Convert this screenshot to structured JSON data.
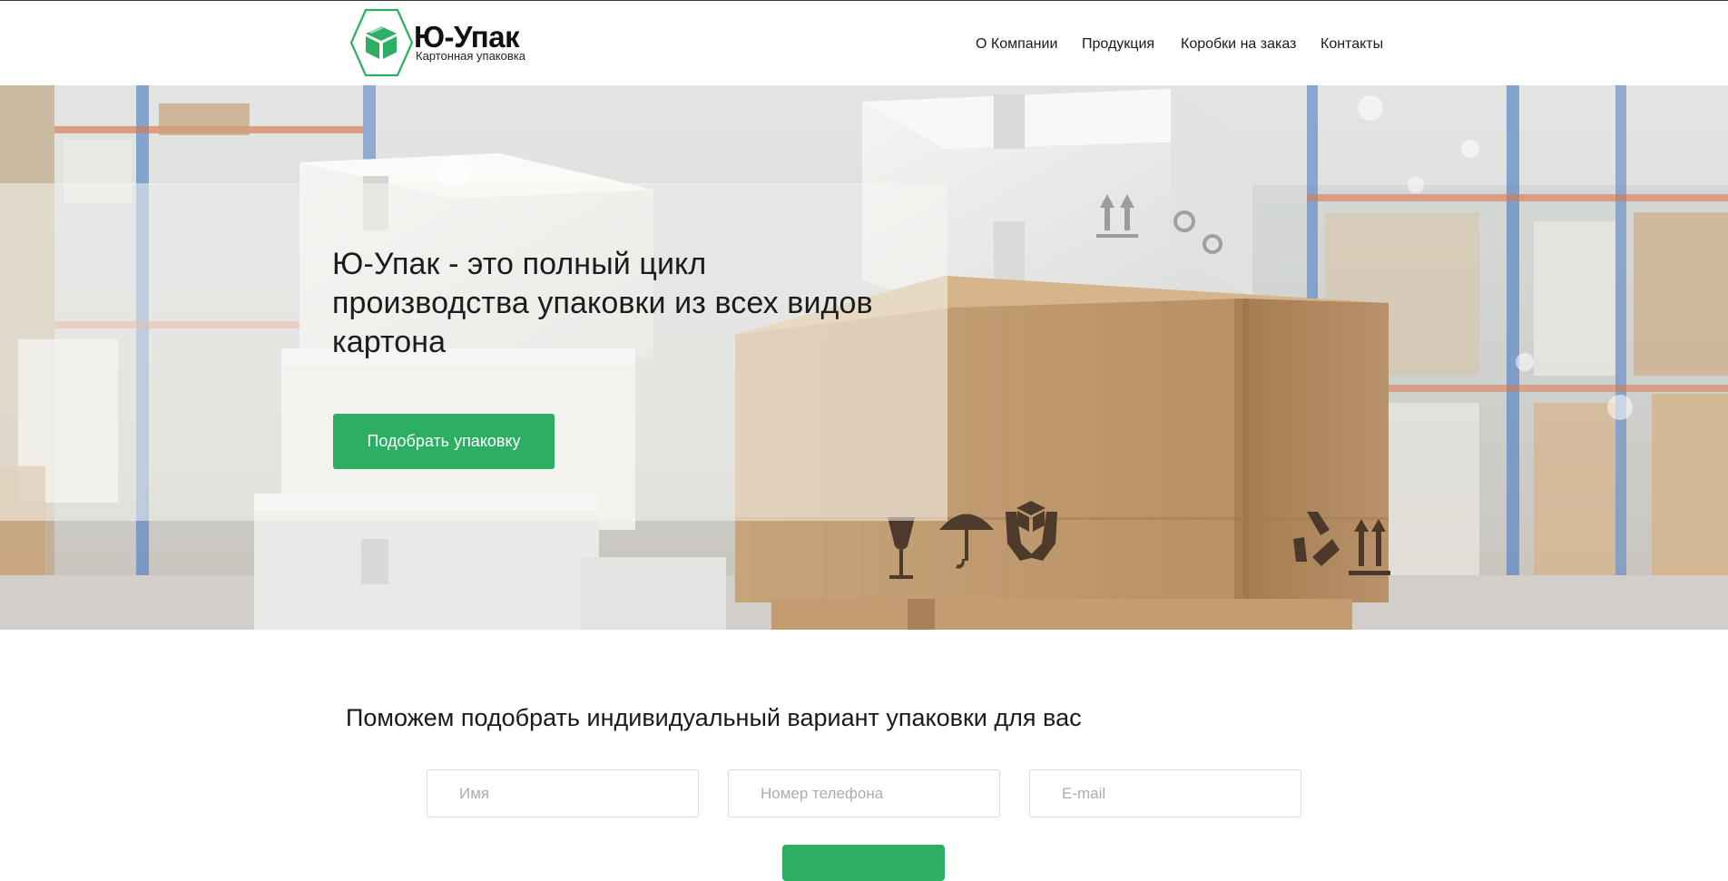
{
  "colors": {
    "brand_green": "#2daf63",
    "text_dark": "#1c1c1c",
    "input_border": "#d9dcdf",
    "placeholder": "#a8adb4"
  },
  "header": {
    "logo": {
      "name": "Ю-Упак",
      "tagline": "Картонная упаковка",
      "icon": "box-hexagon-icon"
    },
    "nav": [
      {
        "label": "О Компании"
      },
      {
        "label": "Продукция"
      },
      {
        "label": "Коробки на заказ"
      },
      {
        "label": "Контакты"
      }
    ]
  },
  "hero": {
    "title": "Ю-Упак - это полный цикл производства упаковки из всех видов картона",
    "cta_label": "Подобрать упаковку",
    "background": "warehouse-boxes-photo"
  },
  "form": {
    "heading": "Поможем подобрать индивидуальный вариант упаковки для вас",
    "fields": {
      "name_placeholder": "Имя",
      "phone_placeholder": "Номер телефона",
      "email_placeholder": "E-mail"
    }
  }
}
